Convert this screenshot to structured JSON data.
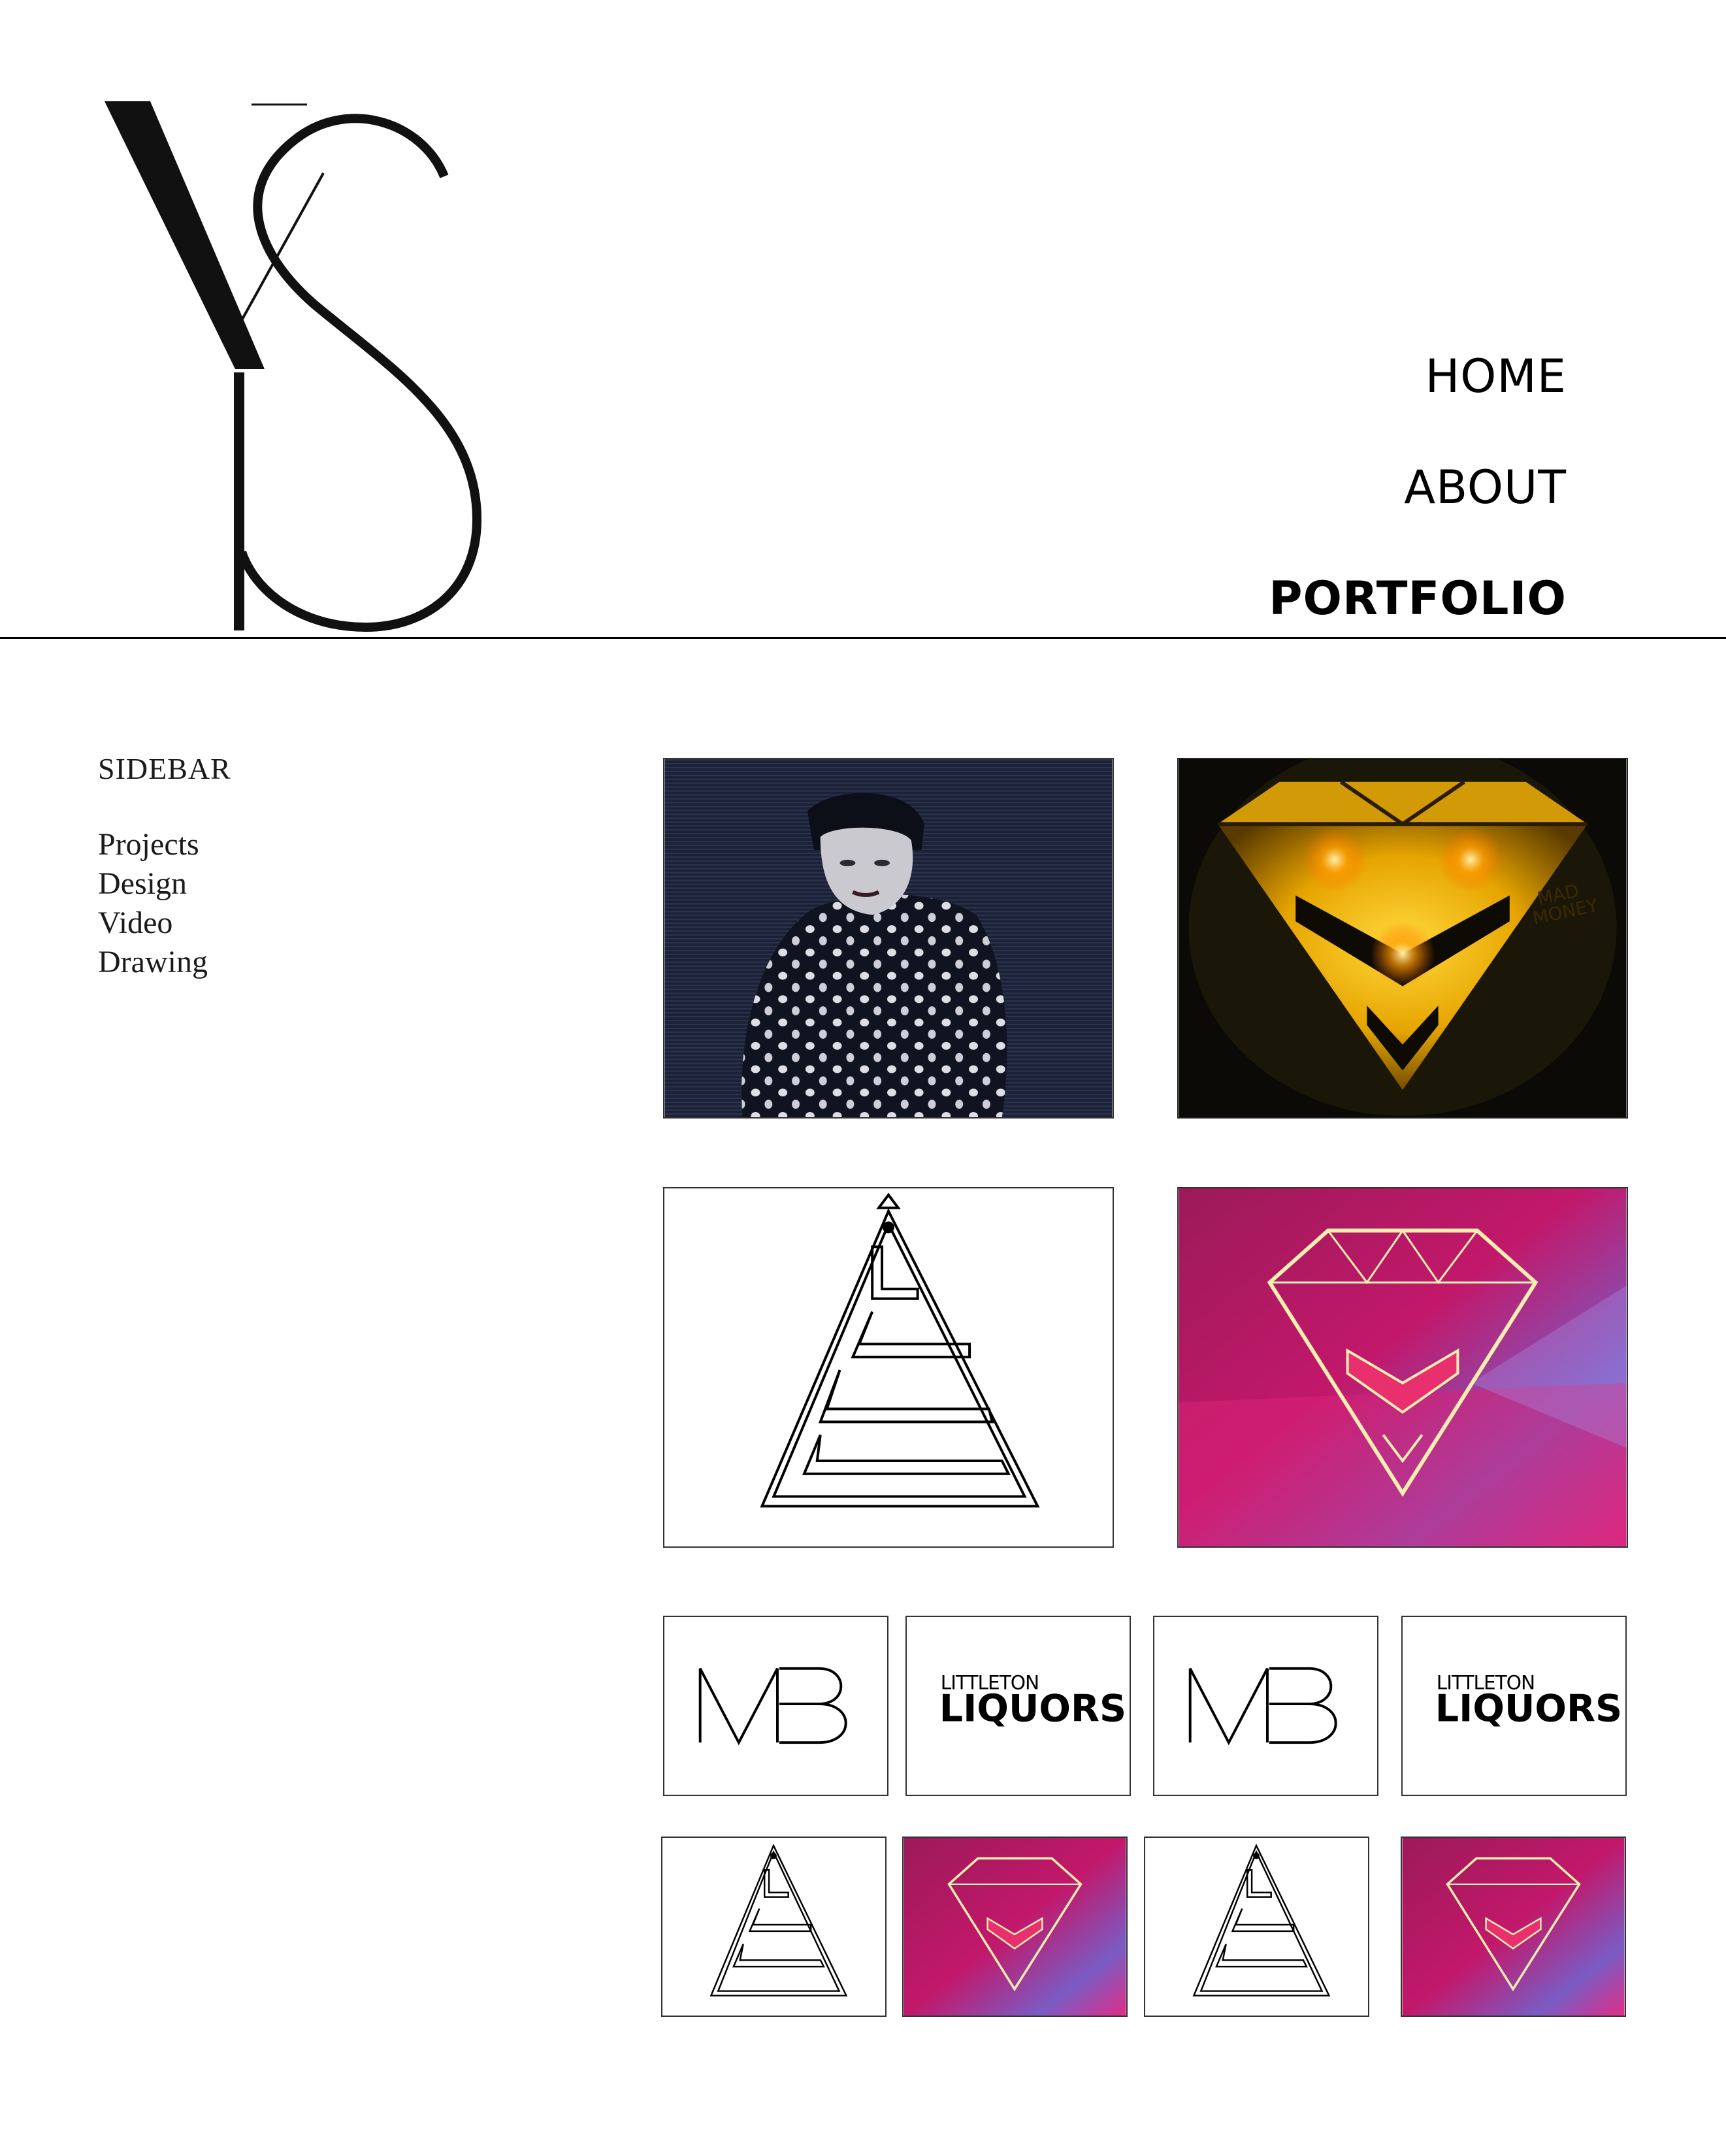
{
  "header": {
    "logo_icon": "ys-monogram-logo",
    "nav": {
      "home": "HOME",
      "about": "ABOUT",
      "portfolio": "PORTFOLIO",
      "active": "PORTFOLIO"
    }
  },
  "sidebar": {
    "title": "SIDEBAR",
    "items": [
      {
        "label": "Projects"
      },
      {
        "label": "Design"
      },
      {
        "label": "Video"
      },
      {
        "label": "Drawing"
      }
    ]
  },
  "gallery": {
    "large": [
      {
        "icon": "woman-portrait-thumbnail"
      },
      {
        "icon": "mad-money-diamond-thumbnail",
        "text_line1": "MAD",
        "text_line2": "MONEY"
      },
      {
        "icon": "maze-triangle-thumbnail"
      },
      {
        "icon": "pink-diamond-thumbnail"
      }
    ],
    "row_a": [
      {
        "icon": "mb-monogram-thumbnail",
        "text": "MB"
      },
      {
        "icon": "littleton-liquors-thumbnail",
        "line1": "LITTLETON",
        "line2": "LIQUORS"
      },
      {
        "icon": "mb-monogram-thumbnail",
        "text": "MB"
      },
      {
        "icon": "littleton-liquors-thumbnail",
        "line1": "LITTLETON",
        "line2": "LIQUORS"
      }
    ],
    "row_b": [
      {
        "icon": "maze-triangle-thumbnail"
      },
      {
        "icon": "pink-diamond-thumbnail"
      },
      {
        "icon": "maze-triangle-thumbnail"
      },
      {
        "icon": "pink-diamond-thumbnail"
      }
    ]
  },
  "colors": {
    "text": "#000000",
    "rule": "#000000",
    "gold": "#f2b705",
    "magenta": "#c2186b",
    "lavender": "#7a5cc4",
    "navy": "#1c2236"
  }
}
